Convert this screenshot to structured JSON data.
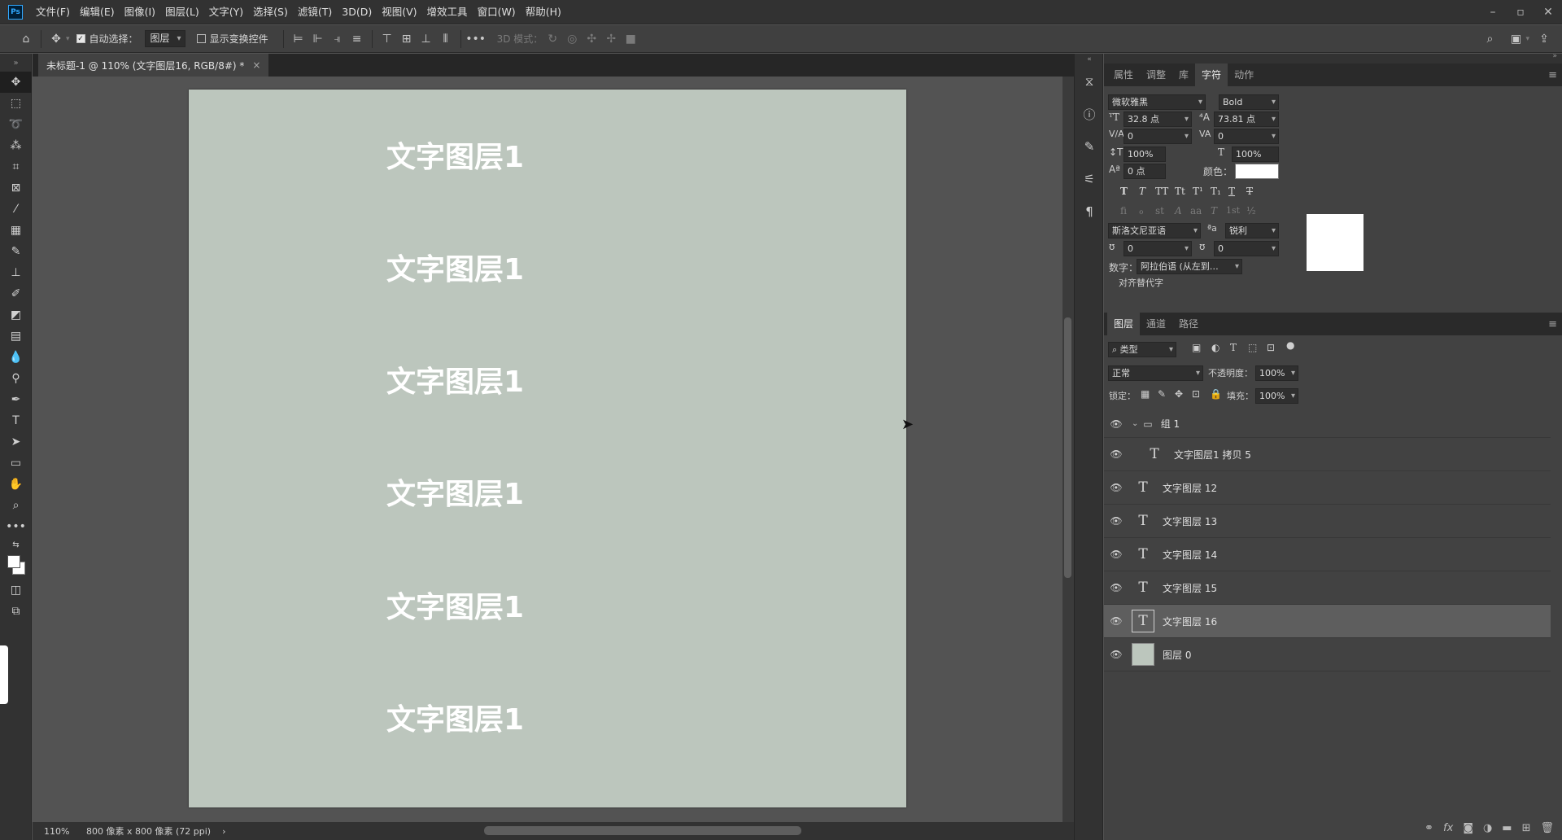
{
  "app": {
    "logo": "Ps"
  },
  "menu": [
    "文件(F)",
    "编辑(E)",
    "图像(I)",
    "图层(L)",
    "文字(Y)",
    "选择(S)",
    "滤镜(T)",
    "3D(D)",
    "视图(V)",
    "增效工具",
    "窗口(W)",
    "帮助(H)"
  ],
  "options": {
    "auto_select_label": "自动选择：",
    "auto_select_value": "图层",
    "show_transform_label": "显示变换控件",
    "mode_3d_label": "3D 模式：",
    "more": "•••"
  },
  "document": {
    "tab_title": "未标题-1 @ 110% (文字图层16, RGB/8#) *",
    "close": "×",
    "canvas_texts": [
      "文字图层1",
      "文字图层1",
      "文字图层1",
      "文字图层1",
      "文字图层1",
      "文字图层1"
    ],
    "canvas_color": "#bcc6bd",
    "zoom": "110%",
    "size_info": "800 像素 x 800 像素 (72 ppi)",
    "status_arrow": "›"
  },
  "character_panel": {
    "tabs": [
      "属性",
      "调整",
      "库",
      "字符",
      "动作"
    ],
    "active_tab": "字符",
    "font_family": "微软雅黑",
    "font_style": "Bold",
    "font_size": "32.8 点",
    "leading": "73.81 点",
    "kerning": "0",
    "tracking": "0",
    "vscale": "100%",
    "hscale": "100%",
    "baseline": "0 点",
    "color_label": "颜色：",
    "color": "#ffffff",
    "language": "斯洛文尼亚语",
    "aa_label": "ªa",
    "antialias": "锐利",
    "field_a": "0",
    "field_b": "0",
    "digits_label": "数字：",
    "digits_value": "阿拉伯语 (从左到…",
    "align_label": "对齐替代字",
    "style_buttons": [
      "T",
      "T",
      "TT",
      "Tt",
      "T¹",
      "T₁",
      "T",
      "T"
    ],
    "opentype_buttons": [
      "ﬁ",
      "ℴ",
      "st",
      "A",
      "aa",
      "T",
      "1st",
      "½"
    ]
  },
  "layers_panel": {
    "tabs": [
      "图层",
      "通道",
      "路径"
    ],
    "active_tab": "图层",
    "filter_label": "类型",
    "blend_mode": "正常",
    "opacity_label": "不透明度：",
    "opacity": "100%",
    "lock_label": "锁定：",
    "fill_label": "填充：",
    "fill": "100%",
    "group_name": "组 1",
    "layers": [
      {
        "name": "文字图层1 拷贝 5",
        "type": "text",
        "indent": true
      },
      {
        "name": "文字图层 12",
        "type": "text"
      },
      {
        "name": "文字图层 13",
        "type": "text"
      },
      {
        "name": "文字图层 14",
        "type": "text"
      },
      {
        "name": "文字图层 15",
        "type": "text"
      },
      {
        "name": "文字图层 16",
        "type": "text",
        "selected": true
      },
      {
        "name": "图层 0",
        "type": "image"
      }
    ],
    "bottom_icons": [
      "link-icon",
      "fx-icon",
      "mask-icon",
      "adjustment-icon",
      "folder-icon",
      "new-layer-icon",
      "trash-icon"
    ]
  }
}
